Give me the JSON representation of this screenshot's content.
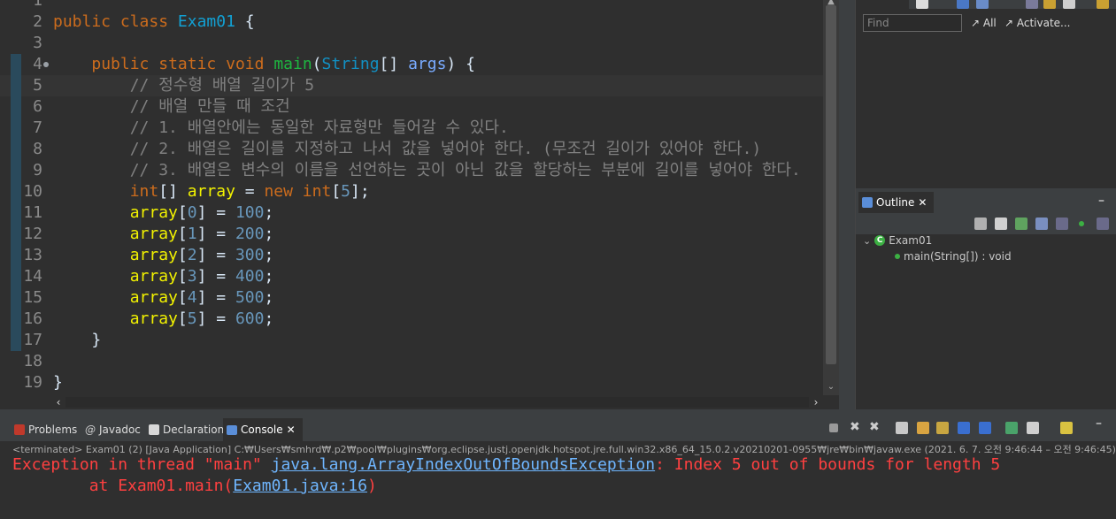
{
  "editor": {
    "lines": [
      {
        "n": "1",
        "html": "",
        "cur": false,
        "changed": false,
        "fold": false
      },
      {
        "n": "2",
        "html": "<span class=\"kw\">public</span> <span class=\"kw\">class</span> <span class=\"ty\">Exam01</span> {",
        "cur": false,
        "changed": false,
        "fold": false
      },
      {
        "n": "3",
        "html": "",
        "cur": false,
        "changed": false,
        "fold": false
      },
      {
        "n": "4",
        "html": "    <span class=\"kw\">public</span> <span class=\"kw\">static</span> <span class=\"kw\">void</span> <span class=\"mth\">main</span>(<span class=\"cls\">String</span>[] <span class=\"par\">args</span>) {",
        "cur": false,
        "changed": true,
        "fold": true
      },
      {
        "n": "5",
        "html": "        <span class=\"cmt\">// 정수형 배열 길이가 5</span>",
        "cur": true,
        "changed": true,
        "fold": false
      },
      {
        "n": "6",
        "html": "        <span class=\"cmt\">// 배열 만들 때 조건</span>",
        "cur": false,
        "changed": true,
        "fold": false
      },
      {
        "n": "7",
        "html": "        <span class=\"cmt\">// 1. 배열안에는 동일한 자료형만 들어갈 수 있다.</span>",
        "cur": false,
        "changed": true,
        "fold": false
      },
      {
        "n": "8",
        "html": "        <span class=\"cmt\">// 2. 배열은 길이를 지정하고 나서 값을 넣어야 한다. (무조건 길이가 있어야 한다.)</span>",
        "cur": false,
        "changed": true,
        "fold": false
      },
      {
        "n": "9",
        "html": "        <span class=\"cmt\">// 3. 배열은 변수의 이름을 선언하는 곳이 아닌 값을 할당하는 부분에 길이를 넣어야 한다.</span>",
        "cur": false,
        "changed": true,
        "fold": false
      },
      {
        "n": "10",
        "html": "        <span class=\"kw\">int</span>[] <span class=\"var\">array</span> = <span class=\"kw\">new</span> <span class=\"kw\">int</span>[<span class=\"num\">5</span>];",
        "cur": false,
        "changed": true,
        "fold": false
      },
      {
        "n": "11",
        "html": "        <span class=\"var\">array</span>[<span class=\"num\">0</span>] = <span class=\"num\">100</span>;",
        "cur": false,
        "changed": true,
        "fold": false
      },
      {
        "n": "12",
        "html": "        <span class=\"var\">array</span>[<span class=\"num\">1</span>] = <span class=\"num\">200</span>;",
        "cur": false,
        "changed": true,
        "fold": false
      },
      {
        "n": "13",
        "html": "        <span class=\"var\">array</span>[<span class=\"num\">2</span>] = <span class=\"num\">300</span>;",
        "cur": false,
        "changed": true,
        "fold": false
      },
      {
        "n": "14",
        "html": "        <span class=\"var\">array</span>[<span class=\"num\">3</span>] = <span class=\"num\">400</span>;",
        "cur": false,
        "changed": true,
        "fold": false
      },
      {
        "n": "15",
        "html": "        <span class=\"var\">array</span>[<span class=\"num\">4</span>] = <span class=\"num\">500</span>;",
        "cur": false,
        "changed": true,
        "fold": false
      },
      {
        "n": "16",
        "html": "        <span class=\"var\">array</span>[<span class=\"num\">5</span>] = <span class=\"num\">600</span>;",
        "cur": false,
        "changed": true,
        "fold": false
      },
      {
        "n": "17",
        "html": "    }",
        "cur": false,
        "changed": true,
        "fold": false
      },
      {
        "n": "18",
        "html": "",
        "cur": false,
        "changed": false,
        "fold": false
      },
      {
        "n": "19",
        "html": "}",
        "cur": false,
        "changed": false,
        "fold": false
      }
    ]
  },
  "task": {
    "find_placeholder": "Find",
    "all_label": "All",
    "activate_label": "Activate..."
  },
  "outline": {
    "tab_label": "Outline",
    "class_name": "Exam01",
    "method_sig": "main(String[]) : void"
  },
  "console": {
    "tabs": [
      "Problems",
      "Javadoc",
      "Declaration",
      "Console"
    ],
    "status": "<terminated> Exam01 (2) [Java Application] C:₩Users₩smhrd₩.p2₩pool₩plugins₩org.eclipse.justj.openjdk.hotspot.jre.full.win32.x86_64_15.0.2.v20210201-0955₩jre₩bin₩javaw.exe  (2021. 6. 7. 오전 9:46:44 – 오전 9:46:45)",
    "err_prefix": "Exception in thread \"main\" ",
    "err_link": "java.lang.ArrayIndexOutOfBoundsException",
    "err_suffix": ": Index 5 out of bounds for length 5",
    "at_prefix": "        at Exam01.main(",
    "at_link": "Exam01.java:16",
    "at_suffix": ")"
  }
}
